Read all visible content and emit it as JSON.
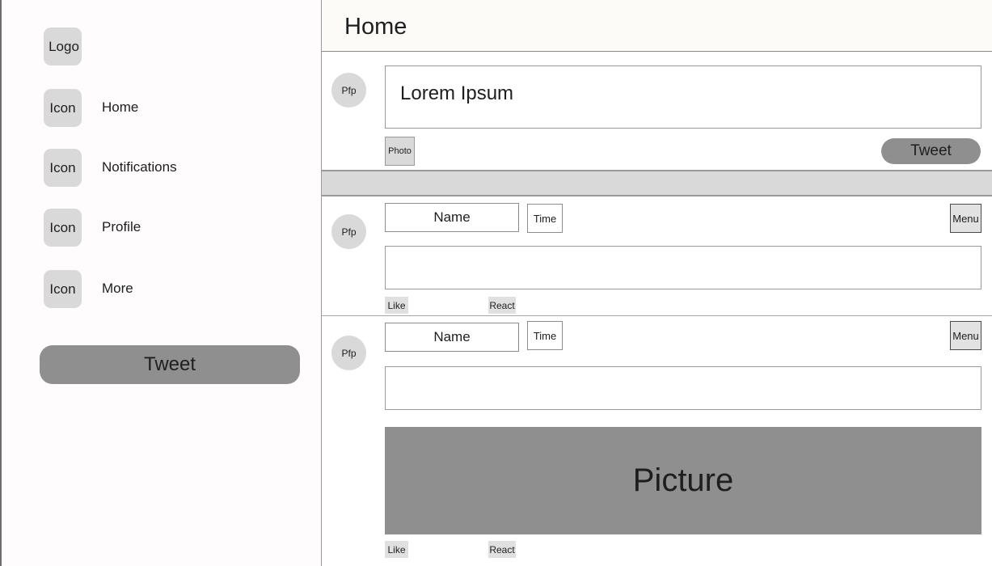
{
  "sidebar": {
    "logo": "Logo",
    "items": [
      {
        "icon": "Icon",
        "label": "Home"
      },
      {
        "icon": "Icon",
        "label": "Notifications"
      },
      {
        "icon": "Icon",
        "label": "Profile"
      },
      {
        "icon": "Icon",
        "label": "More"
      }
    ],
    "tweet_label": "Tweet"
  },
  "header": {
    "title": "Home"
  },
  "compose": {
    "avatar": "Pfp",
    "text": "Lorem Ipsum",
    "photo_label": "Photo",
    "tweet_label": "Tweet"
  },
  "feed": [
    {
      "avatar": "Pfp",
      "name": "Name",
      "time": "Time",
      "menu": "Menu",
      "like": "Like",
      "react": "React"
    },
    {
      "avatar": "Pfp",
      "name": "Name",
      "time": "Time",
      "menu": "Menu",
      "picture": "Picture",
      "like": "Like",
      "react": "React"
    }
  ]
}
